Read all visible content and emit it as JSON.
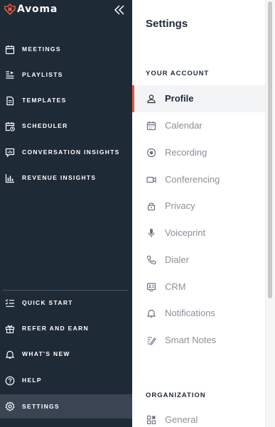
{
  "brand": {
    "name": "Avoma",
    "logo_icon": "avoma-logo-icon",
    "accent": "#e35a3b"
  },
  "sidebar": {
    "collapse_icon": "double-chevron-left-icon",
    "items": [
      {
        "label": "MEETINGS",
        "icon": "calendar-icon"
      },
      {
        "label": "PLAYLISTS",
        "icon": "playlist-icon"
      },
      {
        "label": "TEMPLATES",
        "icon": "document-icon"
      },
      {
        "label": "SCHEDULER",
        "icon": "calendar-clock-icon"
      },
      {
        "label": "CONVERSATION INSIGHTS",
        "icon": "chat-insights-icon"
      },
      {
        "label": "REVENUE INSIGHTS",
        "icon": "bar-chart-icon"
      }
    ],
    "bottom_items": [
      {
        "label": "QUICK START",
        "icon": "checklist-icon"
      },
      {
        "label": "REFER AND EARN",
        "icon": "gift-icon"
      },
      {
        "label": "WHAT'S NEW",
        "icon": "bell-icon"
      },
      {
        "label": "HELP",
        "icon": "help-circle-icon"
      },
      {
        "label": "SETTINGS",
        "icon": "gear-icon",
        "active": true
      }
    ]
  },
  "settings": {
    "title": "Settings",
    "sections": [
      {
        "label": "YOUR ACCOUNT",
        "items": [
          {
            "label": "Profile",
            "icon": "user-icon",
            "active": true
          },
          {
            "label": "Calendar",
            "icon": "calendar-icon"
          },
          {
            "label": "Recording",
            "icon": "record-icon"
          },
          {
            "label": "Conferencing",
            "icon": "video-icon"
          },
          {
            "label": "Privacy",
            "icon": "lock-icon"
          },
          {
            "label": "Voiceprint",
            "icon": "microphone-icon"
          },
          {
            "label": "Dialer",
            "icon": "phone-icon"
          },
          {
            "label": "CRM",
            "icon": "crm-icon"
          },
          {
            "label": "Notifications",
            "icon": "bell-icon"
          },
          {
            "label": "Smart Notes",
            "icon": "notes-icon"
          }
        ]
      },
      {
        "label": "ORGANIZATION",
        "items": [
          {
            "label": "General",
            "icon": "grid-icon"
          }
        ]
      }
    ]
  },
  "colors": {
    "sidebar_bg": "#1f2a37",
    "active_nav_bg": "#3a4452",
    "active_accent": "#e35a3b",
    "muted_text": "#8a9099"
  }
}
